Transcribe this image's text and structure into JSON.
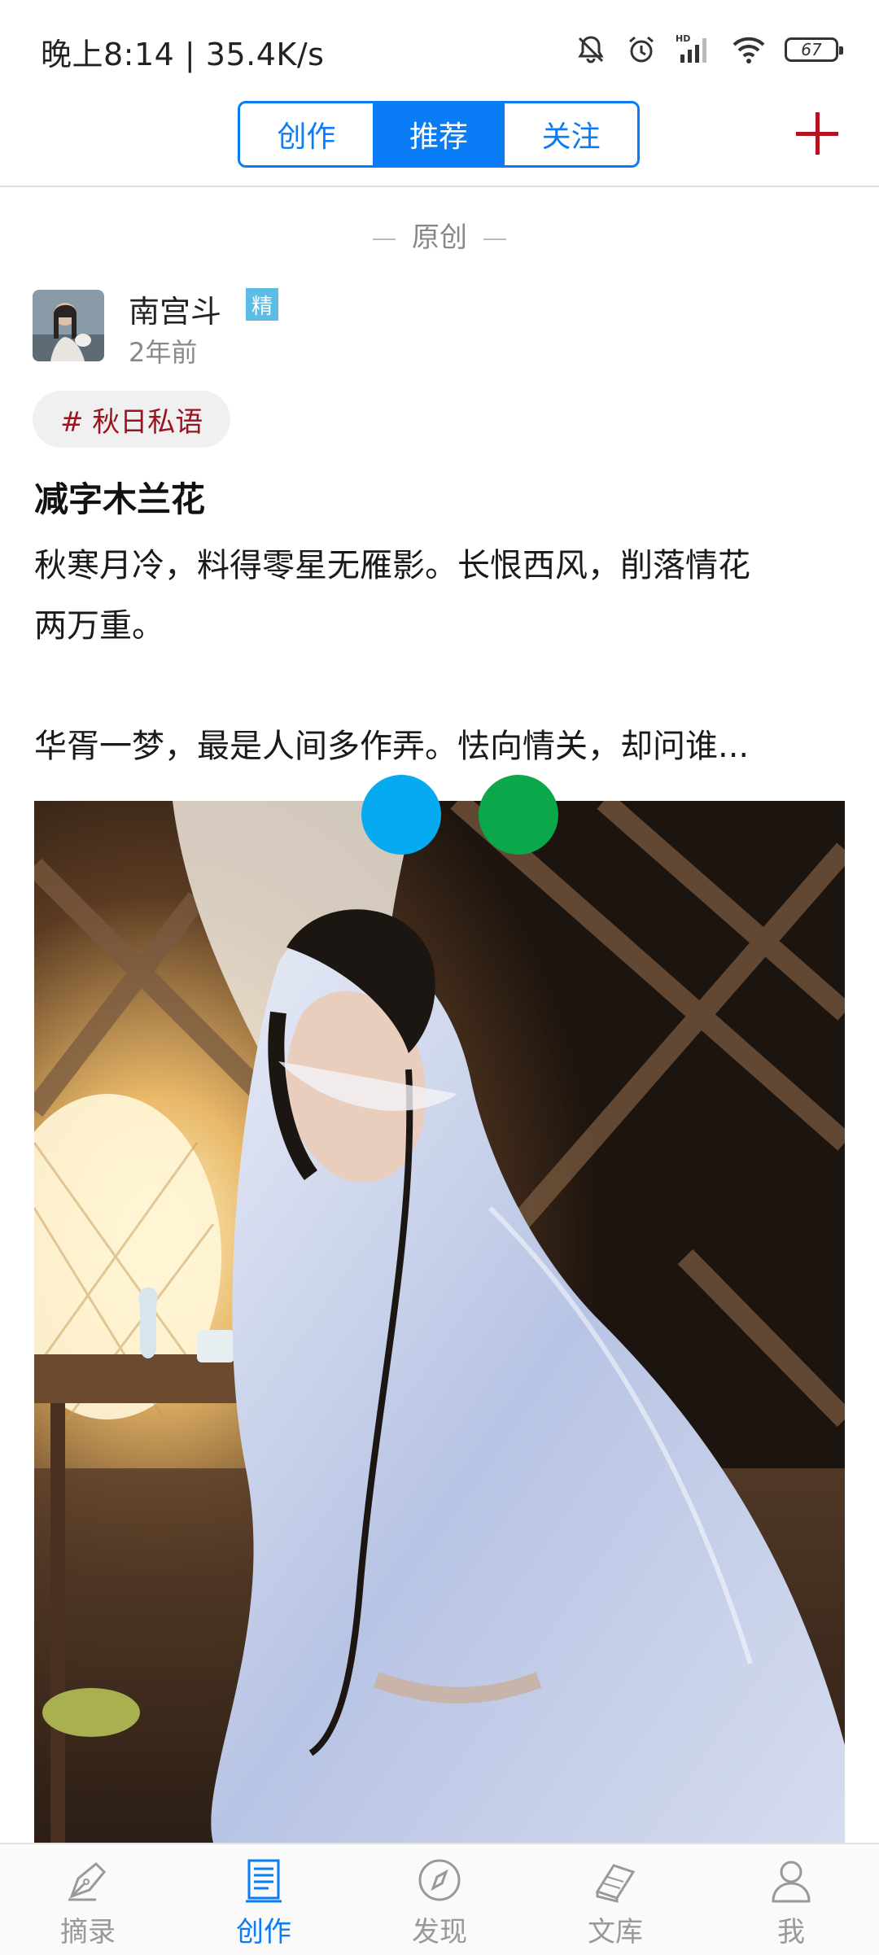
{
  "status_bar": {
    "time_speed": "晚上8:14 | 35.4K/s",
    "battery": "67",
    "network_badge": "HD"
  },
  "top_nav": {
    "tabs": [
      {
        "label": "创作",
        "active": false
      },
      {
        "label": "推荐",
        "active": true
      },
      {
        "label": "关注",
        "active": false
      }
    ],
    "accent_color": "#0a7cf5",
    "add_icon": "plus-icon"
  },
  "post": {
    "section_label": "原创",
    "author": {
      "name": "南宫斗",
      "badge": "精",
      "time_ago": "2年前"
    },
    "topic_tag": "# 秋日私语",
    "title": "减字木兰花",
    "lines": [
      "秋寒月冷，料得零星无雁影。长恨西风，削落情花",
      "两万重。",
      "",
      "华胥一梦，最是人间多作弄。怯向情关，却问谁..."
    ]
  },
  "bottom_nav": {
    "items": [
      {
        "label": "摘录",
        "icon": "pen-nib-icon",
        "active": false
      },
      {
        "label": "创作",
        "icon": "document-icon",
        "active": true
      },
      {
        "label": "发现",
        "icon": "compass-icon",
        "active": false
      },
      {
        "label": "文库",
        "icon": "books-icon",
        "active": false
      },
      {
        "label": "我",
        "icon": "user-icon",
        "active": false
      }
    ]
  }
}
